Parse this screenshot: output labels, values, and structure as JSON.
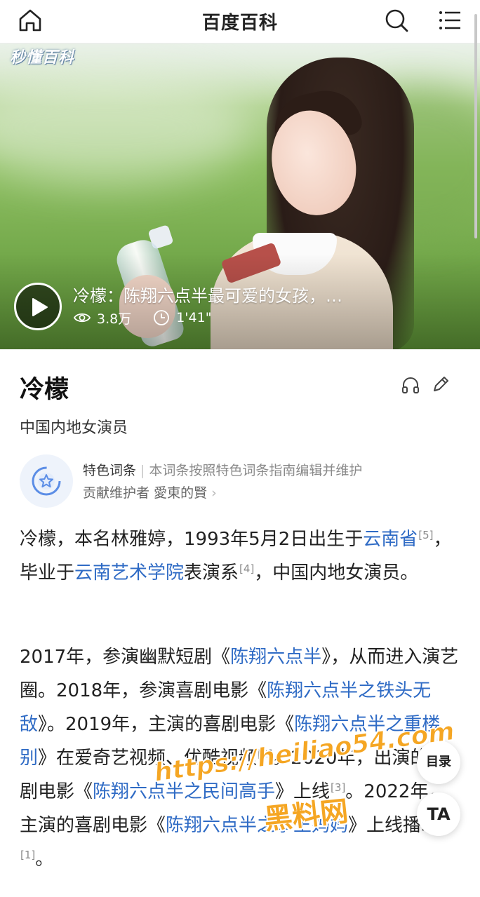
{
  "topbar": {
    "title": "百度百科"
  },
  "video": {
    "watermark": "秒懂百科",
    "title": "冷檬：陈翔六点半最可爱的女孩，…",
    "views": "3.8万",
    "duration": "1'41\""
  },
  "entry": {
    "title": "冷檬",
    "subtitle": "中国内地女演员",
    "feature_label": "特色词条",
    "feature_desc": "本词条按照特色词条指南编辑并维护",
    "maintainer_label": "贡献维护者",
    "maintainer_name": "愛東的賢"
  },
  "para1": {
    "t1": "冷檬，本名林雅婷，1993年5月2日出生于",
    "l1": "云南省",
    "s1": "[5]",
    "t2": "，毕业于",
    "l2": "云南艺术学院",
    "t3": "表演系",
    "s2": "[4]",
    "t4": "，中国内地女演员。"
  },
  "para2": {
    "t1": "2017年，参演幽默短剧《",
    "l1": "陈翔六点半",
    "t2": "》，从而进入演艺圈。2018年，参演喜剧电影《",
    "l2": "陈翔六点半之铁头无敌",
    "t3": "》。2019年，主演的喜剧电影《",
    "l3": "陈翔六点半之重楼别",
    "t4": "》在爱奇艺视频、优酷视频",
    "s1": "[2]",
    "t5": "。2020年，出演的喜剧电影《",
    "l4": "陈翔六点半之民间高手",
    "t6": "》上线",
    "s2": "[3]",
    "t7": "。2022年，主演的喜剧电影《",
    "l5": "陈翔六点半之拳王妈妈",
    "t8": "》上线播映",
    "s3": "[1]",
    "t9": "。"
  },
  "fab": {
    "toc": "目录",
    "ta": "TA"
  },
  "overlay": {
    "url": "https://heiliao54.com",
    "cn": "黑料网"
  },
  "colors": {
    "link": "#2f6bc5",
    "overlay": "#f5a623"
  }
}
